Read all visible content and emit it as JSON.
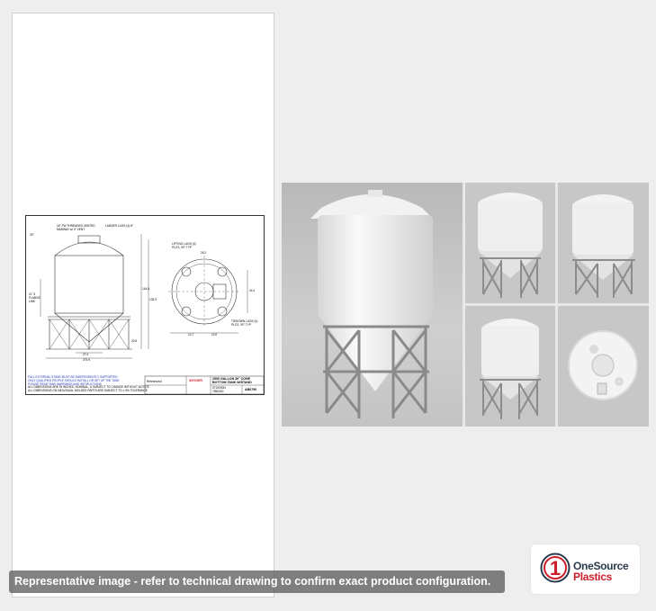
{
  "drawing": {
    "callouts": {
      "dome_threads": "16\" FW THREADED VENTED",
      "manway": "MANWAY w/ 3\" VENT",
      "ladder": "LADDER LUGS (4) 8\"",
      "lifting_lugs": "LIFTING LUGS (4)",
      "lifting_lugs_2": "PLCS, 90° TYP",
      "flange": "FLANGE",
      "flange_line": "LINE",
      "tiedown": "TIEDOWN LUGS (4)",
      "tiedown_2": "PLCS, 90° TYP",
      "slope": "30°",
      "dim_height_left": "11\" 5",
      "dim_height_total": "144.8",
      "dim_height_2": "133.9",
      "dim_bottom_width": "27.4",
      "dim_width": "20.5",
      "dim_base": "274.9",
      "dim_plan_1": "26.2",
      "dim_plan_2": "24.4",
      "dim_plan_3": "14.7",
      "dim_plan_4": "10.0"
    },
    "notes": [
      "FULL EXTERNAL STAND MUST BE INDEPENDENTLY SUPPORTED",
      "ONLY QUALIFIED PEOPLE SHOULD INSTALL OR SET UP THE TANK",
      "PLEASE READ TANK WARNINGS AND INSTRUCTIONS",
      "ALL DIMENSIONS ARE IN INCHES, NOMINAL, & SUBJECT TO CHANGE WITHOUT NOTICE",
      "ALL DIMENSIONS ON INDIVIDUAL MOLDED PARTS ARE SUBJECT TO ± 3% TOLERANCE"
    ],
    "title_block": {
      "brand": "SNYDER",
      "title_line1": "2500 GALLON 30° CONE",
      "title_line2": "BOTTOM TANK W/STAND",
      "part_no": "AB0790",
      "reference": "Referenced",
      "model": "5710000N",
      "stand": "7550000"
    }
  },
  "gallery": {
    "images": [
      {
        "name": "tank-front-large",
        "view": "front"
      },
      {
        "name": "tank-angle-1",
        "view": "angled"
      },
      {
        "name": "tank-angle-2",
        "view": "angled"
      },
      {
        "name": "tank-side",
        "view": "side"
      },
      {
        "name": "tank-top",
        "view": "top"
      }
    ]
  },
  "caption": {
    "text": "Representative image - refer to technical drawing to confirm exact product configuration."
  },
  "logo": {
    "mark": "1",
    "line1": "OneSource",
    "line2": "Plastics",
    "colors": {
      "red": "#cc1f2b",
      "dark": "#2a3a4a"
    }
  }
}
